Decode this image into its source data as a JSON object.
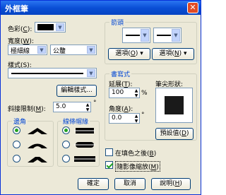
{
  "window": {
    "title": "外框筆",
    "close_glyph": "✕"
  },
  "color": {
    "label_pre": "色彩(",
    "label_key": "C",
    "label_post": "):",
    "value": "#000000"
  },
  "width": {
    "label_pre": "寬度(",
    "label_key": "W",
    "label_post": "):",
    "value": "極細線",
    "unit": "公釐"
  },
  "style": {
    "label_pre": "樣式(",
    "label_key": "S",
    "label_post": "):",
    "edit_button": "編輯樣式..."
  },
  "miter": {
    "label_pre": "斜接限制(",
    "label_key": "M",
    "label_post": "):",
    "value": "5.0",
    "unit": "°"
  },
  "corners": {
    "title": "邊角",
    "selected": 0
  },
  "line_caps": {
    "title": "線條帽緣",
    "selected": 0
  },
  "arrows": {
    "title": "箭頭",
    "options_left_pre": "選項(",
    "options_left_key": "O",
    "options_left_post": ")",
    "options_right_pre": "選項(",
    "options_right_key": "N",
    "options_right_post": ")"
  },
  "calligraphy": {
    "title": "書寫式",
    "stretch_label_pre": "延展(",
    "stretch_label_key": "T",
    "stretch_label_post": "):",
    "stretch_value": "100",
    "stretch_unit": "%",
    "angle_label_pre": "角度(",
    "angle_label_key": "A",
    "angle_label_post": "):",
    "angle_value": "0.0",
    "angle_unit": "°",
    "nib_label": "筆尖形狀:",
    "default_button_pre": "預設值(",
    "default_button_key": "D",
    "default_button_post": ")"
  },
  "behind_fill": {
    "label_pre": "在填色之後(",
    "label_key": "B",
    "label_post": ")",
    "checked": false
  },
  "scale_with_image": {
    "label_pre": "隨影像縮放(",
    "label_key": "M",
    "label_post": ")",
    "checked": true
  },
  "buttons": {
    "ok": "確定",
    "cancel": "取消",
    "help_pre": "說明(",
    "help_key": "H",
    "help_post": ")"
  }
}
